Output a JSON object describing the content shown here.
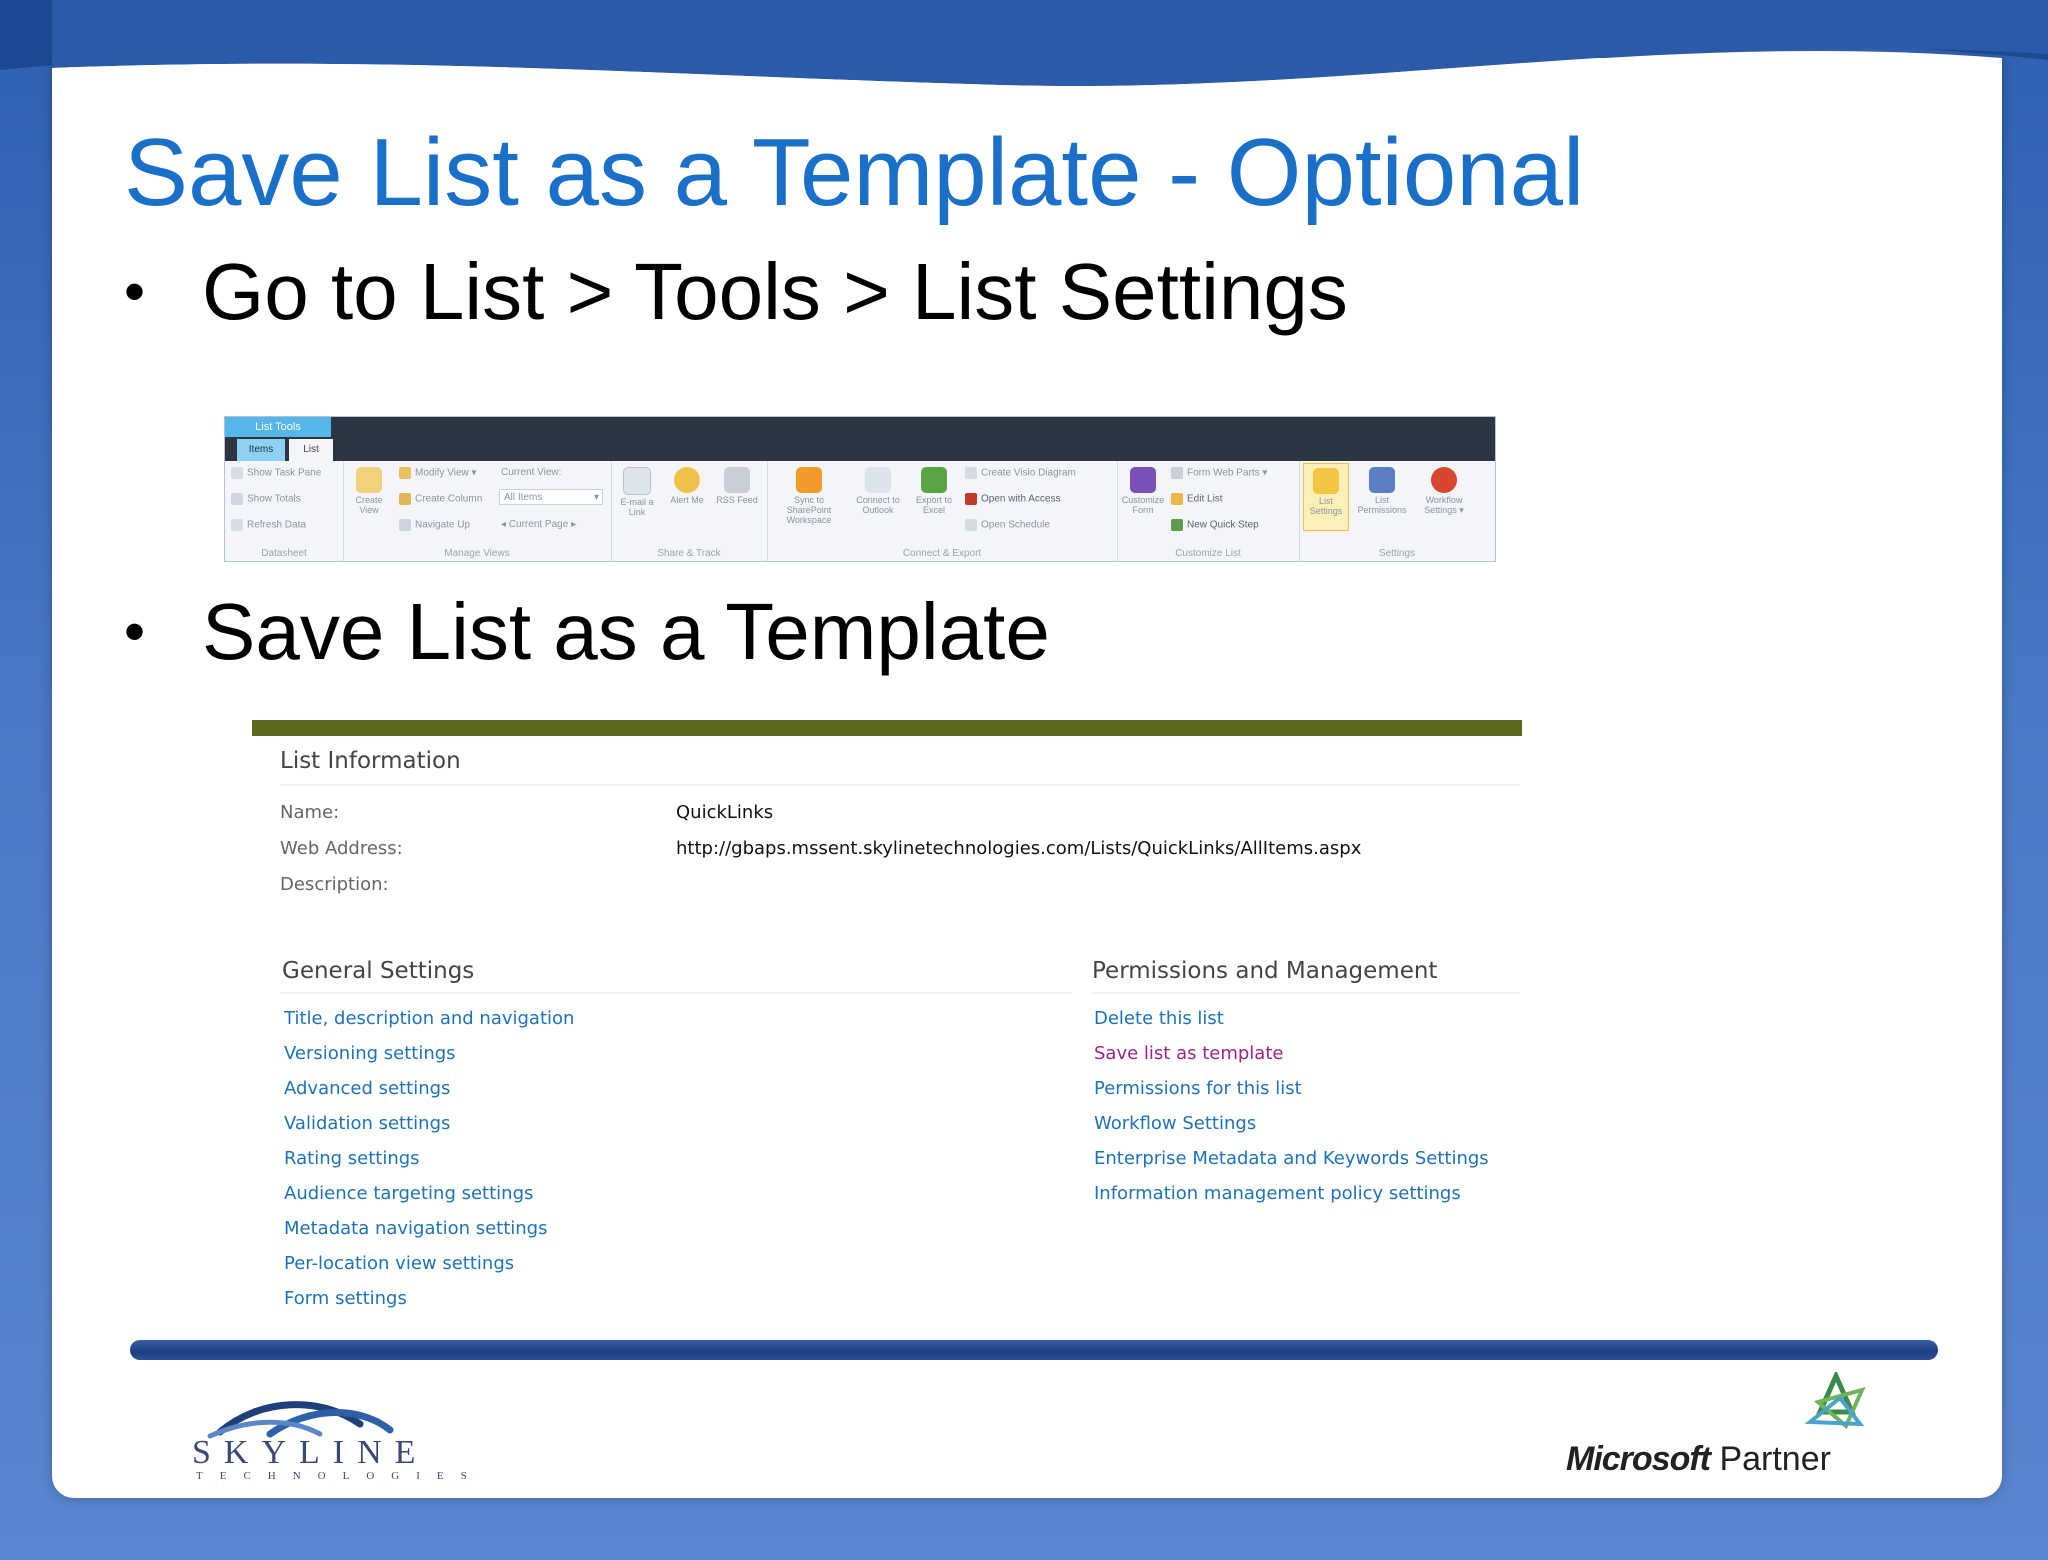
{
  "slide": {
    "title": "Save List as a Template - Optional",
    "bullets": [
      "Go to List > Tools > List Settings",
      "Save List as a Template"
    ],
    "bullet_char": "•"
  },
  "ribbon": {
    "context_tab": "List Tools",
    "tabs": [
      "Items",
      "List"
    ],
    "datasheet": {
      "items": [
        "Show Task Pane",
        "Show Totals",
        "Refresh Data"
      ],
      "label": "Datasheet"
    },
    "manage_views": {
      "create_view": "Create View",
      "items": [
        "Modify View",
        "Create Column",
        "Navigate Up"
      ],
      "current_view_label": "Current View:",
      "current_view_value": "All Items",
      "current_page": "Current Page",
      "label": "Manage Views"
    },
    "share_track": {
      "items": [
        "E-mail a Link",
        "Alert Me",
        "RSS Feed"
      ],
      "label": "Share & Track"
    },
    "connect_export": {
      "items": [
        "Sync to SharePoint Workspace",
        "Connect to Outlook",
        "Export to Excel"
      ],
      "small_items": [
        "Create Visio Diagram",
        "Open with Access",
        "Open Schedule"
      ],
      "label": "Connect & Export"
    },
    "customize_list": {
      "customize_form": "Customize Form",
      "items": [
        "Form Web Parts",
        "Edit List",
        "New Quick Step"
      ],
      "label": "Customize List"
    },
    "settings": {
      "items": [
        "List Settings",
        "List Permissions",
        "Workflow Settings"
      ],
      "label": "Settings"
    }
  },
  "list_info": {
    "heading": "List Information",
    "name_label": "Name:",
    "name_value": "QuickLinks",
    "web_label": "Web Address:",
    "web_value": "http://gbaps.mssent.skylinetechnologies.com/Lists/QuickLinks/AllItems.aspx",
    "desc_label": "Description:"
  },
  "general_settings": {
    "heading": "General Settings",
    "links": [
      "Title, description and navigation",
      "Versioning settings",
      "Advanced settings",
      "Validation settings",
      "Rating settings",
      "Audience targeting settings",
      "Metadata navigation settings",
      "Per-location view settings",
      "Form settings"
    ]
  },
  "permissions": {
    "heading": "Permissions and Management",
    "links": [
      "Delete this list",
      "Save list as template",
      "Permissions for this list",
      "Workflow Settings",
      "Enterprise Metadata and Keywords Settings",
      "Information management policy settings"
    ],
    "visited_link": "Save list as template"
  },
  "footer": {
    "skyline_name": "SKYLINE",
    "skyline_tagline": "TECHNOLOGIES",
    "ms_brand": "Microsoft",
    "ms_partner": "Partner"
  },
  "colors": {
    "title": "#1a6fc9",
    "link": "#1e72b8",
    "visited_link": "#a0218a",
    "olive_bar": "#5c6a1c"
  }
}
